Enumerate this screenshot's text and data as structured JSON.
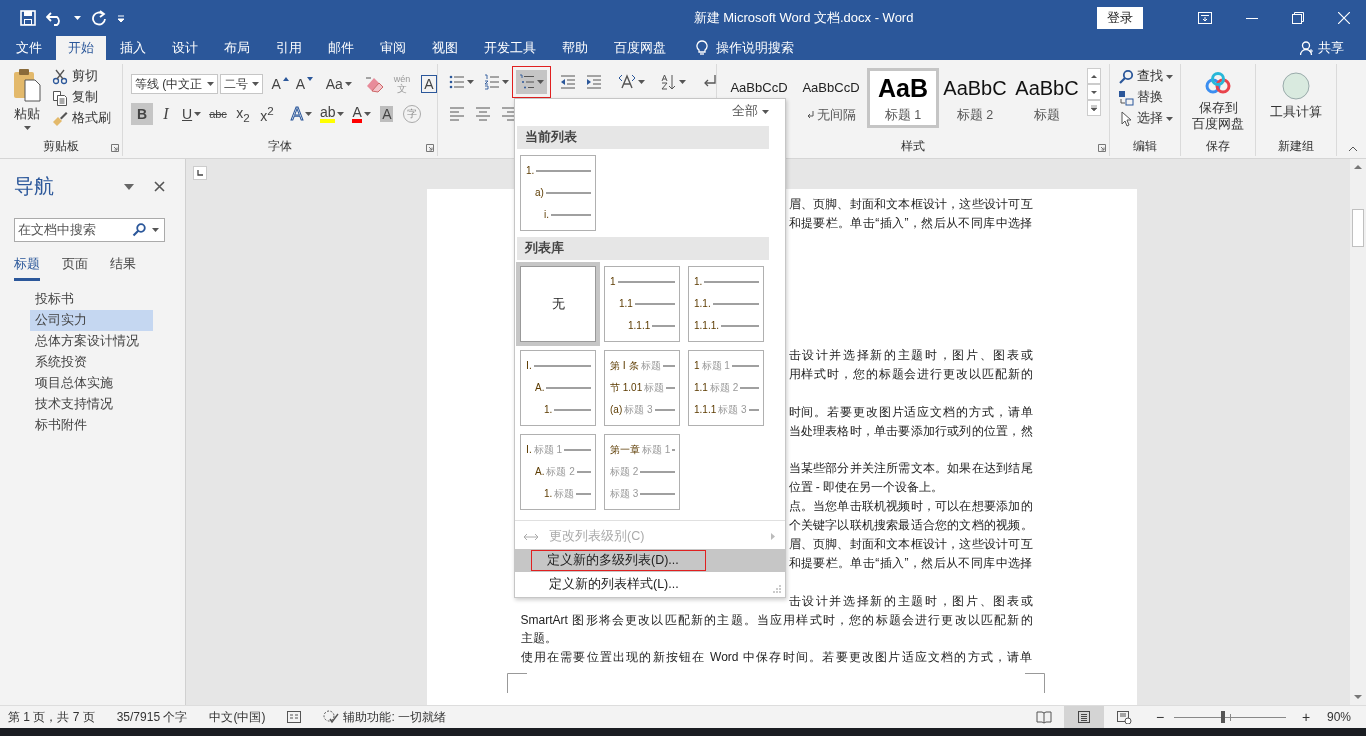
{
  "window": {
    "title": "新建 Microsoft Word 文档.docx  -  Word",
    "sign_in": "登录"
  },
  "ribbon_tabs": [
    {
      "label": "文件",
      "selected": false
    },
    {
      "label": "开始",
      "selected": true
    },
    {
      "label": "插入",
      "selected": false
    },
    {
      "label": "设计",
      "selected": false
    },
    {
      "label": "布局",
      "selected": false
    },
    {
      "label": "引用",
      "selected": false
    },
    {
      "label": "邮件",
      "selected": false
    },
    {
      "label": "审阅",
      "selected": false
    },
    {
      "label": "视图",
      "selected": false
    },
    {
      "label": "开发工具",
      "selected": false
    },
    {
      "label": "帮助",
      "selected": false
    },
    {
      "label": "百度网盘",
      "selected": false
    }
  ],
  "tell_me": "操作说明搜索",
  "share": "共享",
  "clipboard": {
    "paste": "粘贴",
    "actions": [
      {
        "label": "剪切",
        "kind": "cut"
      },
      {
        "label": "复制",
        "kind": "copy"
      },
      {
        "label": "格式刷",
        "kind": "painter"
      }
    ],
    "group": "剪贴板"
  },
  "font": {
    "name": "等线 (中文正",
    "size": "二号",
    "group": "字体",
    "row1": [
      {
        "kind": "grow",
        "label": "A"
      },
      {
        "kind": "shrink",
        "label": "A"
      },
      {
        "kind": "case",
        "label": "Aa"
      },
      {
        "kind": "clear"
      },
      {
        "kind": "phonetic",
        "label": "wén",
        "sub": "文"
      },
      {
        "kind": "boxed",
        "label": "A"
      }
    ],
    "row2": [
      {
        "kind": "bold",
        "label": "B",
        "selected": true
      },
      {
        "kind": "italic",
        "label": "I",
        "selected": false
      },
      {
        "kind": "underline",
        "label": "U",
        "selected": false
      },
      {
        "kind": "strike",
        "label": "abc",
        "selected": false
      },
      {
        "kind": "plain",
        "label": "x$_{2}$",
        "selected": false
      },
      {
        "kind": "plain",
        "label": "x$^{2}$",
        "selected": false
      },
      {
        "kind": "effect",
        "label": "A",
        "selected": false
      },
      {
        "kind": "color",
        "label": "ab",
        "color": "#ffff00",
        "selected": false
      },
      {
        "kind": "color",
        "label": "A",
        "color": "#ff0000",
        "selected": false
      },
      {
        "kind": "shaded",
        "label": "A",
        "selected": false
      },
      {
        "kind": "circled",
        "label": "字",
        "selected": false
      }
    ]
  },
  "paragraph": {
    "row1": [
      {
        "kind": "bullets",
        "expanded": false
      },
      {
        "kind": "numbering",
        "expanded": false
      },
      {
        "kind": "multilevel",
        "expanded": true,
        "highlighted": true
      },
      {
        "kind": "outdent",
        "expanded": false
      },
      {
        "kind": "indent",
        "expanded": false
      },
      {
        "kind": "asian",
        "expanded": false
      },
      {
        "kind": "sort",
        "expanded": false
      },
      {
        "kind": "marks",
        "expanded": false
      }
    ],
    "row2": [
      {
        "kind": "left"
      },
      {
        "kind": "center"
      },
      {
        "kind": "right"
      }
    ]
  },
  "styles": {
    "group": "样式",
    "items": [
      {
        "preview": "AaBbCcD",
        "kind": "body",
        "selected": false
      },
      {
        "preview": "AaBbCcD",
        "label": "无间隔",
        "kind": "nospacing",
        "selected": false
      },
      {
        "preview": "AaB",
        "label": "标题 1",
        "kind": "h1",
        "selected": true
      },
      {
        "preview": "AaBbC",
        "label": "标题 2",
        "kind": "h2",
        "selected": false
      },
      {
        "preview": "AaBbC",
        "label": "标题",
        "kind": "h2",
        "selected": false
      }
    ]
  },
  "editing": {
    "group": "编辑",
    "actions": [
      {
        "label": "查找",
        "kind": "find"
      },
      {
        "label": "替换",
        "kind": "replace"
      },
      {
        "label": "选择",
        "kind": "select"
      }
    ]
  },
  "save": {
    "label_lines": [
      "保存到",
      "百度网盘"
    ],
    "group": "保存"
  },
  "custom": {
    "label": "工具计算",
    "group": "新建组"
  },
  "navigation": {
    "title": "导航",
    "search_placeholder": "在文档中搜索",
    "tabs": [
      {
        "label": "标题",
        "selected": true
      },
      {
        "label": "页面",
        "selected": false
      },
      {
        "label": "结果",
        "selected": false
      }
    ],
    "headings": [
      {
        "label": "投标书",
        "selected": false
      },
      {
        "label": "公司实力",
        "selected": true
      },
      {
        "label": "总体方案设计情况",
        "selected": false
      },
      {
        "label": "系统投资",
        "selected": false
      },
      {
        "label": "项目总体实施",
        "selected": false
      },
      {
        "label": "技术支持情况",
        "selected": false
      },
      {
        "label": "标书附件",
        "selected": false
      }
    ]
  },
  "document": {
    "lines": [
      {
        "kind": "cut",
        "text": "眉、页脚、封面和文本框设计，这些设计可互"
      },
      {
        "kind": "cut",
        "text": "和提要栏。单击“插入”，然后从不同库中选择"
      },
      {
        "kind": "blank"
      },
      {
        "kind": "blank"
      },
      {
        "kind": "blank"
      },
      {
        "kind": "blank"
      },
      {
        "kind": "blank"
      },
      {
        "kind": "blank"
      },
      {
        "kind": "cut",
        "text": "击设计并选择新的主题时，图片、图表或"
      },
      {
        "kind": "cut",
        "text": "用样式时，您的标题会进行更改以匹配新的"
      },
      {
        "kind": "blank"
      },
      {
        "kind": "cut",
        "text": "时间。若要更改图片适应文档的方式，请单"
      },
      {
        "kind": "cut",
        "text": "当处理表格时，单击要添加行或列的位置，然"
      },
      {
        "kind": "blank"
      },
      {
        "kind": "cut",
        "text": "当某些部分并关注所需文本。如果在达到结尾"
      },
      {
        "kind": "cut_end",
        "text": "位置 - 即使在另一个设备上。"
      },
      {
        "kind": "cut",
        "text": "点。当您单击联机视频时，可以在想要添加的"
      },
      {
        "kind": "cut",
        "text": "个关键字以联机搜索最适合您的文档的视频。"
      },
      {
        "kind": "cut",
        "text": "眉、页脚、封面和文本框设计，这些设计可互"
      },
      {
        "kind": "cut",
        "text": "和提要栏。单击“插入”，然后从不同库中选择"
      },
      {
        "kind": "blank"
      },
      {
        "kind": "cut",
        "text": "击设计并选择新的主题时，图片、图表或"
      },
      {
        "kind": "full",
        "text": "SmartArt 图形将会更改以匹配新的主题。当应用样式时，您的标题会进行更改以匹配新的"
      },
      {
        "kind": "end",
        "text": "主题。"
      },
      {
        "kind": "full",
        "text": "使用在需要位置出现的新按钮在 Word 中保存时间。若要更改图片适应文档的方式，请单"
      }
    ]
  },
  "list_menu": {
    "filter": "全部",
    "current_section": "当前列表",
    "current_list": {
      "kind": "indented",
      "rows": [
        {
          "num": "1."
        },
        {
          "num": "a)"
        },
        {
          "num": "i."
        }
      ]
    },
    "library_section": "列表库",
    "library": [
      {
        "kind": "none",
        "label": "无",
        "selected": true
      },
      {
        "kind": "indented",
        "selected": false,
        "rows": [
          {
            "num": "1"
          },
          {
            "num": "1.1"
          },
          {
            "num": "1.1.1"
          }
        ]
      },
      {
        "kind": "flat",
        "selected": false,
        "rows": [
          {
            "num": "1."
          },
          {
            "num": "1.1."
          },
          {
            "num": "1.1.1."
          }
        ]
      },
      {
        "kind": "indented",
        "selected": false,
        "rows": [
          {
            "num": "Ⅰ."
          },
          {
            "num": "A."
          },
          {
            "num": "1."
          }
        ]
      },
      {
        "kind": "flat",
        "selected": false,
        "rows": [
          {
            "num": "第 Ⅰ 条",
            "heading": "标题"
          },
          {
            "num": "节 1.01",
            "heading": "标题"
          },
          {
            "num": "(a)",
            "heading": "标题 3"
          }
        ]
      },
      {
        "kind": "flat",
        "selected": false,
        "rows": [
          {
            "num": "1",
            "heading": "标题 1"
          },
          {
            "num": "1.1",
            "heading": "标题 2"
          },
          {
            "num": "1.1.1",
            "heading": "标题 3"
          }
        ]
      },
      {
        "kind": "indented",
        "selected": false,
        "rows": [
          {
            "num": "Ⅰ.",
            "heading": "标题 1"
          },
          {
            "num": "A.",
            "heading": "标题 2"
          },
          {
            "num": "1.",
            "heading": "标题"
          }
        ]
      },
      {
        "kind": "flat",
        "selected": false,
        "rows": [
          {
            "num": "第一章",
            "heading": "标题 1"
          },
          {
            "heading": "标题 2"
          },
          {
            "heading": "标题 3"
          }
        ]
      }
    ],
    "menu": [
      {
        "label": "更改列表级别(C)",
        "kind": "level",
        "disabled": true,
        "highlighted": false,
        "framed": false
      },
      {
        "label": "定义新的多级列表(D)...",
        "kind": "plain",
        "disabled": false,
        "highlighted": true,
        "framed": true
      },
      {
        "label": "定义新的列表样式(L)...",
        "kind": "plain",
        "disabled": false,
        "highlighted": false,
        "framed": false
      }
    ]
  },
  "status_bar": {
    "page": "第 1 页，共 7 页",
    "words": "35/7915 个字",
    "language": "中文(中国)",
    "accessibility": "辅助功能: 一切就绪",
    "views": [
      {
        "kind": "read",
        "selected": false
      },
      {
        "kind": "print",
        "selected": true
      },
      {
        "kind": "web",
        "selected": false
      }
    ],
    "zoom_out": "−",
    "zoom_in": "+",
    "zoom": {
      "level": 0.44,
      "reading": "90%"
    }
  }
}
